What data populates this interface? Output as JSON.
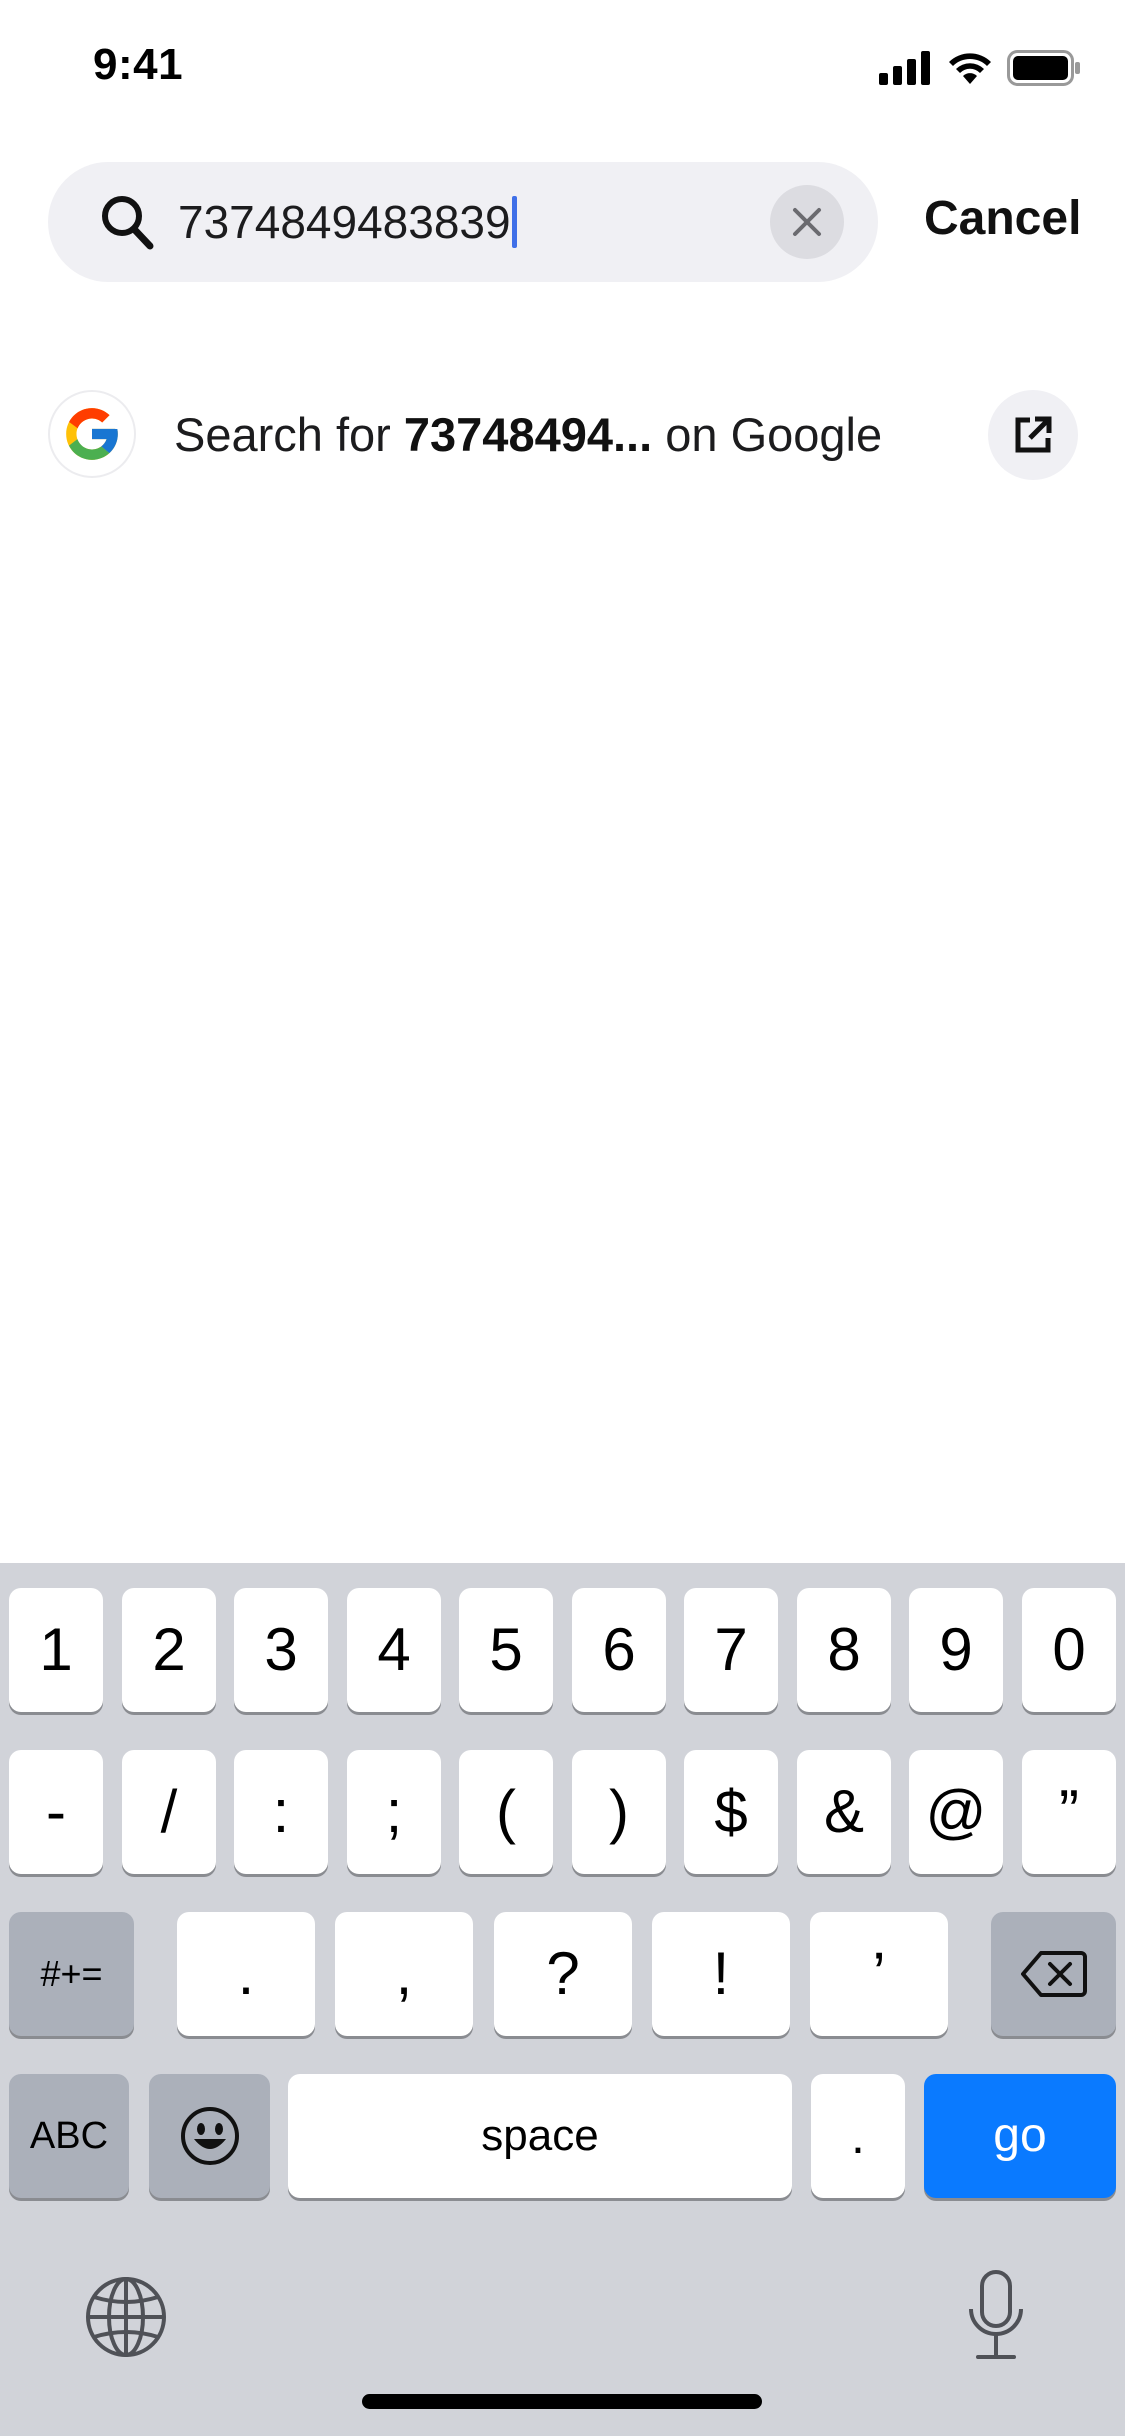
{
  "status_bar": {
    "time": "9:41",
    "icons": [
      "cellular-signal-icon",
      "wifi-icon",
      "battery-icon"
    ]
  },
  "search": {
    "value": "7374849483839",
    "icon": "search-icon",
    "clear_icon": "clear-icon",
    "cancel_label": "Cancel"
  },
  "suggestion": {
    "prefix": "Search for ",
    "query_bold": "73748494...",
    "suffix": " on Google",
    "logo_icon": "google-logo-icon",
    "action_icon": "open-external-icon"
  },
  "keyboard": {
    "row1": [
      "1",
      "2",
      "3",
      "4",
      "5",
      "6",
      "7",
      "8",
      "9",
      "0"
    ],
    "row2": [
      "-",
      "/",
      ":",
      ";",
      "(",
      ")",
      "$",
      "&",
      "@",
      "”"
    ],
    "row3": {
      "symbols_label": "#+=",
      "keys": [
        ".",
        ",",
        "?",
        "!",
        "’"
      ],
      "delete_icon": "backspace-icon"
    },
    "row4": {
      "abc_label": "ABC",
      "emoji_icon": "emoji-icon",
      "space_label": "space",
      "period_label": ".",
      "go_label": "go"
    },
    "globe_icon": "globe-icon",
    "mic_icon": "microphone-icon"
  },
  "colors": {
    "accent_blue": "#0a7aff",
    "caret": "#3f6fe8",
    "keyboard_bg": "#d1d3d9",
    "search_field_bg": "#f0f0f4"
  }
}
